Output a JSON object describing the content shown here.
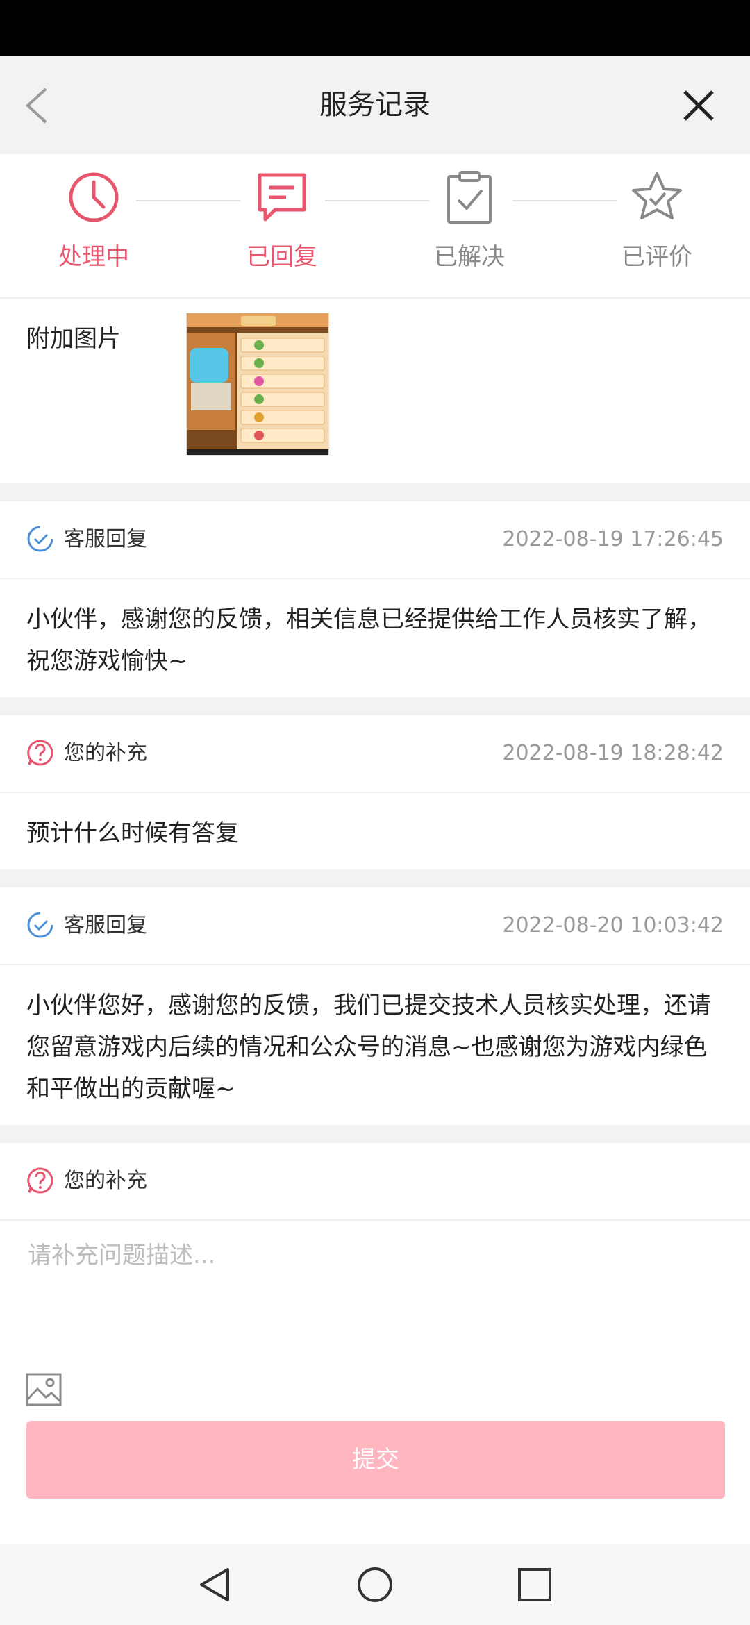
{
  "header": {
    "title": "服务记录"
  },
  "steps": [
    {
      "label": "处理中",
      "state": "active",
      "icon": "clock-icon"
    },
    {
      "label": "已回复",
      "state": "active",
      "icon": "message-icon"
    },
    {
      "label": "已解决",
      "state": "inactive",
      "icon": "clipboard-check-icon"
    },
    {
      "label": "已评价",
      "state": "inactive",
      "icon": "star-check-icon"
    }
  ],
  "attachment": {
    "label": "附加图片"
  },
  "records": [
    {
      "type": "客服回复",
      "time": "2022-08-19 17:26:45",
      "text": "小伙伴，感谢您的反馈，相关信息已经提供给工作人员核实了解，祝您游戏愉快~",
      "icon": "check-circle-icon"
    },
    {
      "type": "您的补充",
      "time": "2022-08-19 18:28:42",
      "text": "预计什么时候有答复",
      "icon": "question-circle-icon"
    },
    {
      "type": "客服回复",
      "time": "2022-08-20 10:03:42",
      "text": "小伙伴您好，感谢您的反馈，我们已提交技术人员核实处理，还请您留意游戏内后续的情况和公众号的消息~也感谢您为游戏内绿色和平做出的贡献喔~",
      "icon": "check-circle-icon"
    }
  ],
  "compose": {
    "type": "您的补充",
    "placeholder": "请补充问题描述...",
    "submit_label": "提交"
  },
  "colors": {
    "accent": "#e8566e",
    "submit_bg": "#ffb6c1",
    "reply_icon": "#4a90d9"
  }
}
